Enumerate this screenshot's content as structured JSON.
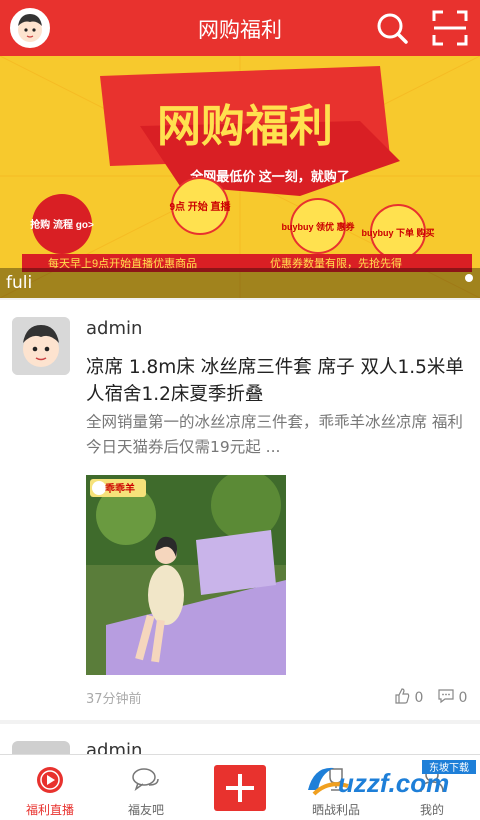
{
  "header": {
    "title": "网购福利"
  },
  "banner": {
    "caption": "fuli",
    "headline": "网购福利",
    "sub": "全网最低价 这一刻，就购了",
    "badges": [
      "抢购 流程 go>",
      "9点 开始 直播",
      "buybuy 领优 惠券",
      "buybuy 下单 购买"
    ],
    "footer_left": "每天早上9点开始直播优惠商品",
    "footer_right": "优惠券数量有限，先抢先得"
  },
  "post": {
    "user": "admin",
    "title": "凉席 1.8m床 冰丝席三件套 席子 双人1.5米单人宿舍1.2床夏季折叠",
    "desc": "全网销量第一的冰丝凉席三件套，乖乖羊冰丝凉席 福利 今日天猫券后仅需19元起 ...",
    "image_brand": "乖乖羊",
    "time": "37分钟前",
    "likes": "0",
    "comments": "0"
  },
  "post2": {
    "user": "admin"
  },
  "nav": {
    "tabs": [
      {
        "label": "福利直播",
        "icon": "play-circle-icon",
        "active": true
      },
      {
        "label": "福友吧",
        "icon": "chat-bubbles-icon",
        "active": false
      },
      {
        "label": "",
        "icon": "plus-icon",
        "active": false
      },
      {
        "label": "晒战利品",
        "icon": "trophy-icon",
        "active": false
      },
      {
        "label": "我的",
        "icon": "person-icon",
        "active": false
      }
    ]
  },
  "watermark": {
    "text": "uzzf.com",
    "tag": "东坡下载"
  },
  "colors": {
    "brand": "#e8322e",
    "banner_yellow": "#f7c92d"
  }
}
